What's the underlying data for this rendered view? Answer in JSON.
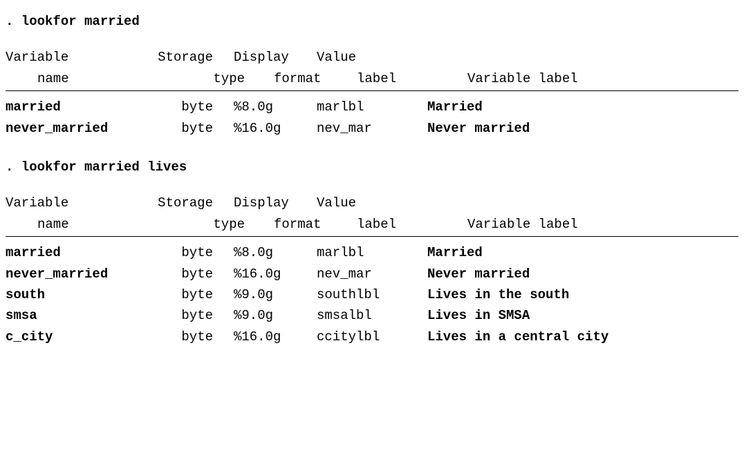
{
  "sections": [
    {
      "command": ". lookfor married",
      "header": {
        "l1": {
          "name": "Variable",
          "type": "Storage",
          "format": "Display",
          "vallbl": "Value",
          "varlbl": ""
        },
        "l2": {
          "name": "name",
          "type": "type",
          "format": "format",
          "vallbl": "label",
          "varlbl": "Variable label"
        }
      },
      "rows": [
        {
          "name": "married",
          "type": "byte",
          "format": "%8.0g",
          "vallbl": "marlbl",
          "varlbl": "Married"
        },
        {
          "name": "never_married",
          "type": "byte",
          "format": "%16.0g",
          "vallbl": "nev_mar",
          "varlbl": "Never married"
        }
      ]
    },
    {
      "command": ". lookfor married lives",
      "header": {
        "l1": {
          "name": "Variable",
          "type": "Storage",
          "format": "Display",
          "vallbl": "Value",
          "varlbl": ""
        },
        "l2": {
          "name": "name",
          "type": "type",
          "format": "format",
          "vallbl": "label",
          "varlbl": "Variable label"
        }
      },
      "rows": [
        {
          "name": "married",
          "type": "byte",
          "format": "%8.0g",
          "vallbl": "marlbl",
          "varlbl": "Married"
        },
        {
          "name": "never_married",
          "type": "byte",
          "format": "%16.0g",
          "vallbl": "nev_mar",
          "varlbl": "Never married"
        },
        {
          "name": "south",
          "type": "byte",
          "format": "%9.0g",
          "vallbl": "southlbl",
          "varlbl": "Lives in the south"
        },
        {
          "name": "smsa",
          "type": "byte",
          "format": "%9.0g",
          "vallbl": "smsalbl",
          "varlbl": "Lives in SMSA"
        },
        {
          "name": "c_city",
          "type": "byte",
          "format": "%16.0g",
          "vallbl": "ccitylbl",
          "varlbl": "Lives in a central city"
        }
      ]
    }
  ]
}
